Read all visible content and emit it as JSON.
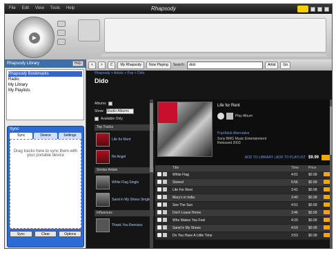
{
  "app": {
    "title_logo": "Rhapsody",
    "menu": [
      "File",
      "Edit",
      "View",
      "Tools",
      "Help"
    ]
  },
  "library": {
    "header_label": "Rhapsody Library",
    "header_button": "Help",
    "tree": [
      "Rhapsody Bookmarks",
      "Radio",
      "My Library",
      "My Playlists"
    ]
  },
  "sync": {
    "title": "Sync",
    "tabs": [
      "Sync",
      "Device",
      "Settings"
    ],
    "message": "Drag tracks here to sync them with your portable device",
    "footer": [
      "Sync",
      "Clear",
      "Options"
    ]
  },
  "toolbar": {
    "back": "<",
    "forward": ">",
    "refresh": "C",
    "btn_my_rhapsody": "My Rhapsody",
    "btn_now_playing": "Now Playing",
    "search_label": "Search:",
    "search_value": "dido",
    "search_scope": "Artist",
    "search_go": "Go"
  },
  "breadcrumb": "Rhapsody > Artists > Pop > Dido",
  "page_title": "Dido",
  "filters": {
    "albums_label": "Albums",
    "show_label": "Show:",
    "show_value": "Studio Albums",
    "available_label": "Available Only"
  },
  "sections": {
    "top_tracks": "Top Tracks",
    "similar": "Similar Artists",
    "influences": "Influences"
  },
  "related": [
    {
      "name": "Life for Rent"
    },
    {
      "name": "No Angel"
    },
    {
      "name": "White Flag Single"
    },
    {
      "name": "Sand in My Shoes Single"
    },
    {
      "name": "Thank You Remixes"
    }
  ],
  "album": {
    "title": "Life for Rent",
    "play_label": "Play Album",
    "link": "Pop/Adult Alternative",
    "meta1": "Sony BMG Music Entertainment",
    "meta2": "Released 2003",
    "actions": "ADD TO LIBRARY | ADD TO PLAYLIST",
    "price": "$9.99",
    "buy": "BUY"
  },
  "track_header": {
    "col_title": "Title",
    "col_time": "Time",
    "col_price": "Price"
  },
  "tracks": [
    {
      "title": "White Flag",
      "time": "4:01",
      "price": "$0.99"
    },
    {
      "title": "Stoned",
      "time": "5:56",
      "price": "$0.99"
    },
    {
      "title": "Life For Rent",
      "time": "3:41",
      "price": "$0.99"
    },
    {
      "title": "Mary's in India",
      "time": "3:40",
      "price": "$0.99"
    },
    {
      "title": "See The Sun",
      "time": "4:51",
      "price": "$0.99"
    },
    {
      "title": "Don't Leave Home",
      "time": "3:46",
      "price": "$0.99"
    },
    {
      "title": "Who Makes You Feel",
      "time": "4:20",
      "price": "$0.99"
    },
    {
      "title": "Sand In My Shoes",
      "time": "4:59",
      "price": "$0.99"
    },
    {
      "title": "Do You Have A Little Time",
      "time": "3:53",
      "price": "$0.99"
    }
  ],
  "colors": {
    "accent": "#f2a800",
    "link": "#6f9fe6",
    "panel": "#2a6bd6"
  }
}
